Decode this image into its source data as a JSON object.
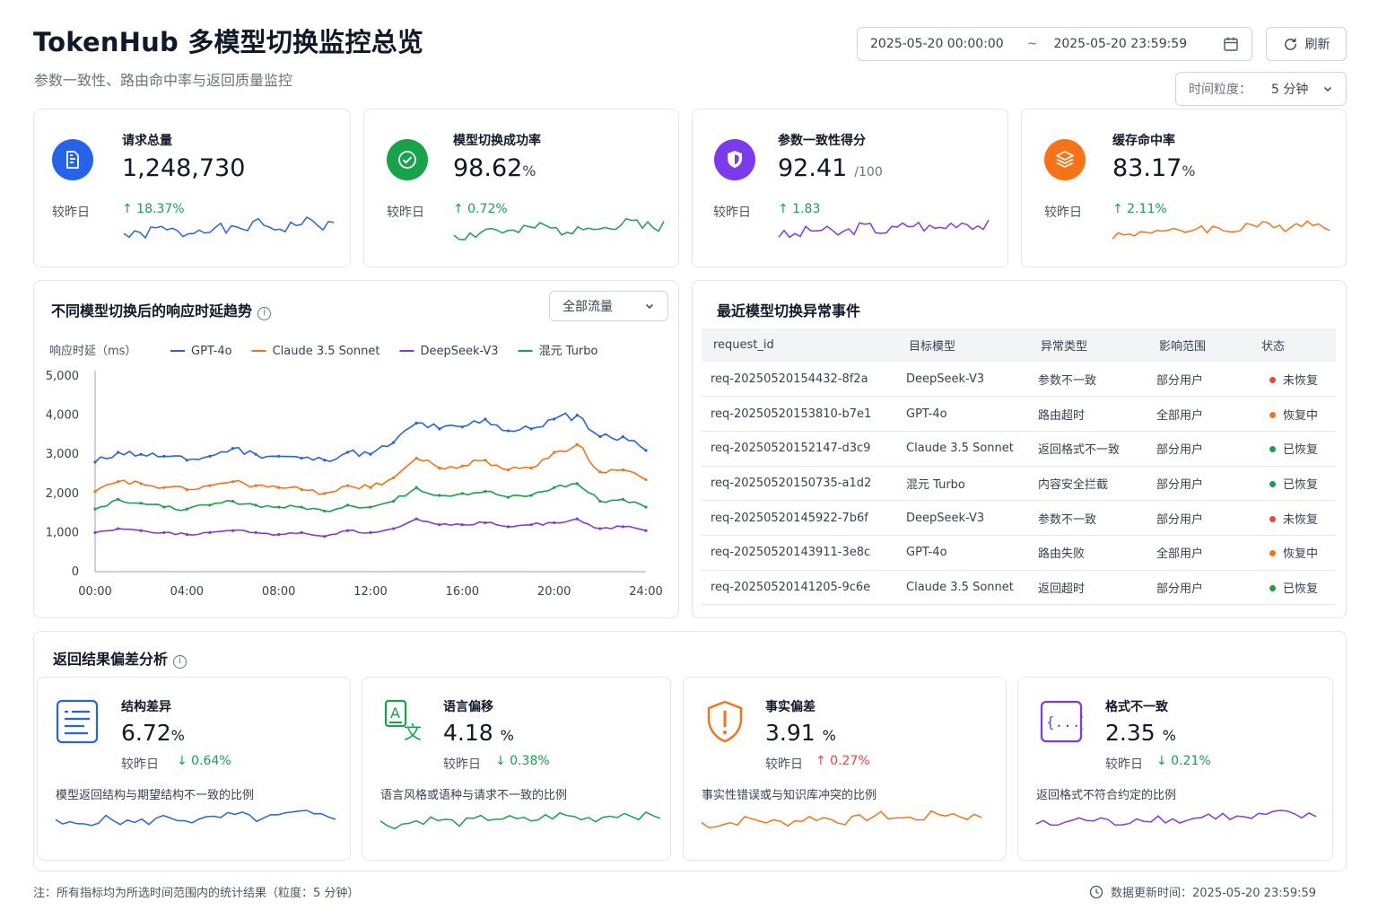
{
  "header": {
    "title": "TokenHub 多模型切换监控总览",
    "subtitle": "参数一致性、路由命中率与返回质量监控",
    "date_start": "2025-05-20  00:00:00",
    "date_sep": "~",
    "date_end": "2025-05-20  23:59:59",
    "refresh_label": "刷新",
    "granularity_label": "时间粒度：",
    "granularity_value": "5 分钟"
  },
  "kpis": [
    {
      "label": "请求总量",
      "value": "1,248,730",
      "unit": "",
      "compare": "较昨日",
      "delta": "↑ 18.37%",
      "color": "#2563eb",
      "icon": "document-chart-icon"
    },
    {
      "label": "模型切换成功率",
      "value": "98.62",
      "unit": "%",
      "compare": "较昨日",
      "delta": "↑ 0.72%",
      "color": "#16a34a",
      "icon": "check-circle-icon"
    },
    {
      "label": "参数一致性得分",
      "value": "92.41",
      "unit": "/100",
      "compare": "较昨日",
      "delta": "↑ 1.83",
      "color": "#7c3aed",
      "icon": "shield-icon"
    },
    {
      "label": "缓存命中率",
      "value": "83.17",
      "unit": "%",
      "compare": "较昨日",
      "delta": "↑ 2.11%",
      "color": "#f97316",
      "icon": "layers-icon"
    }
  ],
  "latency": {
    "title": "不同模型切换后的响应时延趋势",
    "filter": "全部流量",
    "ylabel": "响应时延（ms）"
  },
  "chart_data": {
    "type": "line",
    "title": "不同模型切换后的响应时延趋势",
    "ylabel": "响应时延（ms）",
    "xlabel": "",
    "x_ticks": [
      "00:00",
      "04:00",
      "08:00",
      "12:00",
      "16:00",
      "20:00",
      "24:00"
    ],
    "y_ticks": [
      "5,000",
      "4,000",
      "3,000",
      "2,000",
      "1,000",
      "0"
    ],
    "ylim": [
      0,
      5000
    ],
    "xlim_hours": [
      0,
      24
    ],
    "legend": "top",
    "grid": false,
    "x_hours": [
      0,
      1,
      2,
      3,
      4,
      5,
      6,
      7,
      8,
      9,
      10,
      11,
      12,
      13,
      14,
      15,
      16,
      17,
      18,
      19,
      20,
      21,
      22,
      23,
      24
    ],
    "series": [
      {
        "name": "GPT-4o",
        "color": "#2563eb",
        "values": [
          2800,
          3050,
          3000,
          2950,
          2850,
          2950,
          3150,
          3000,
          2950,
          2900,
          2850,
          3050,
          3000,
          3300,
          3800,
          3650,
          3700,
          3900,
          3600,
          3650,
          3900,
          4000,
          3450,
          3450,
          3100
        ]
      },
      {
        "name": "Claude 3.5 Sonnet",
        "color": "#f97316",
        "values": [
          2050,
          2300,
          2250,
          2150,
          2100,
          2200,
          2300,
          2200,
          2150,
          2100,
          2000,
          2200,
          2150,
          2400,
          2900,
          2650,
          2700,
          2850,
          2600,
          2650,
          3050,
          3250,
          2550,
          2600,
          2350
        ]
      },
      {
        "name": "DeepSeek-V3",
        "color": "#7c3aed",
        "values": [
          1000,
          1100,
          1050,
          1000,
          950,
          1000,
          1050,
          1000,
          950,
          1000,
          900,
          1050,
          1000,
          1100,
          1350,
          1200,
          1200,
          1250,
          1150,
          1200,
          1250,
          1350,
          1100,
          1150,
          1050
        ]
      },
      {
        "name": "混元 Turbo",
        "color": "#16a34a",
        "values": [
          1600,
          1850,
          1750,
          1650,
          1600,
          1700,
          1800,
          1700,
          1650,
          1650,
          1550,
          1700,
          1650,
          1800,
          2150,
          1950,
          2000,
          2050,
          1900,
          1950,
          2150,
          2250,
          1800,
          1850,
          1650
        ]
      }
    ]
  },
  "events": {
    "title": "最近模型切换异常事件",
    "columns": [
      "request_id",
      "目标模型",
      "异常类型",
      "影响范围",
      "状态"
    ],
    "rows": [
      {
        "id": "req-20250520154432-8f2a",
        "model": "DeepSeek-V3",
        "type": "参数不一致",
        "scope": "部分用户",
        "status": "未恢复",
        "color": "#ef4444"
      },
      {
        "id": "req-20250520153810-b7e1",
        "model": "GPT-4o",
        "type": "路由超时",
        "scope": "全部用户",
        "status": "恢复中",
        "color": "#f97316"
      },
      {
        "id": "req-20250520152147-d3c9",
        "model": "Claude 3.5 Sonnet",
        "type": "返回格式不一致",
        "scope": "部分用户",
        "status": "已恢复",
        "color": "#16a34a"
      },
      {
        "id": "req-20250520150735-a1d2",
        "model": "混元 Turbo",
        "type": "内容安全拦截",
        "scope": "部分用户",
        "status": "已恢复",
        "color": "#16a34a"
      },
      {
        "id": "req-20250520145922-7b6f",
        "model": "DeepSeek-V3",
        "type": "参数不一致",
        "scope": "部分用户",
        "status": "未恢复",
        "color": "#ef4444"
      },
      {
        "id": "req-20250520143911-3e8c",
        "model": "GPT-4o",
        "type": "路由失败",
        "scope": "全部用户",
        "status": "恢复中",
        "color": "#f97316"
      },
      {
        "id": "req-20250520141205-9c6e",
        "model": "Claude 3.5 Sonnet",
        "type": "返回超时",
        "scope": "部分用户",
        "status": "已恢复",
        "color": "#16a34a"
      }
    ]
  },
  "deviation": {
    "title": "返回结果偏差分析",
    "cards": [
      {
        "label": "结构差异",
        "value": "6.72",
        "unit": "%",
        "compare": "较昨日",
        "delta": "↓ 0.64%",
        "delta_color": "#16a34a",
        "desc": "模型返回结构与期望结构不一致的比例",
        "color": "#2563eb",
        "icon": "list-document-icon"
      },
      {
        "label": "语言偏移",
        "value": "4.18",
        "unit": "%",
        "compare": "较昨日",
        "delta": "↓ 0.38%",
        "delta_color": "#16a34a",
        "desc": "语言风格或语种与请求不一致的比例",
        "color": "#16a34a",
        "icon": "translate-icon"
      },
      {
        "label": "事实偏差",
        "value": "3.91",
        "unit": "%",
        "compare": "较昨日",
        "delta": "↑ 0.27%",
        "delta_color": "#ef4444",
        "desc": "事实性错误或与知识库冲突的比例",
        "color": "#f97316",
        "icon": "warning-shield-icon"
      },
      {
        "label": "格式不一致",
        "value": "2.35",
        "unit": "%",
        "compare": "较昨日",
        "delta": "↓ 0.21%",
        "delta_color": "#16a34a",
        "desc": "返回格式不符合约定的比例",
        "color": "#7c3aed",
        "icon": "braces-icon"
      }
    ]
  },
  "footer": {
    "note": "注：所有指标均为所选时间范围内的统计结果（粒度：5 分钟）",
    "update_label": "数据更新时间：2025-05-20 23:59:59"
  }
}
